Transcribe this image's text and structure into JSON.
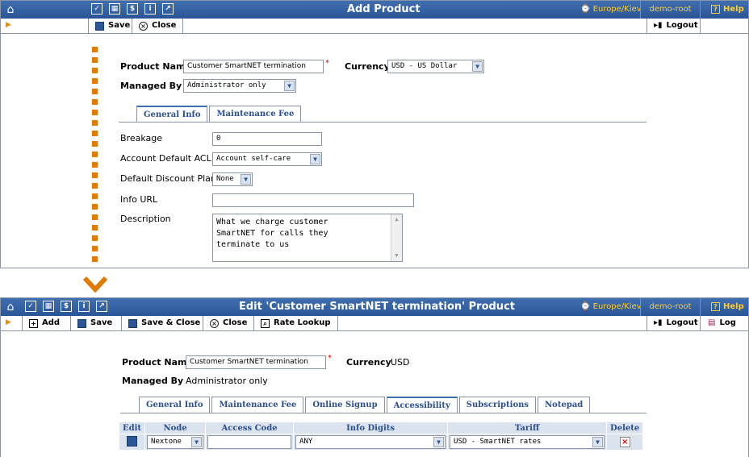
{
  "window1": {
    "title": "Add Product",
    "timezone": "Europe/Kiev",
    "user": "demo-root",
    "help": "Help",
    "toolbar": {
      "save": "Save",
      "close": "Close",
      "logout": "Logout"
    },
    "form": {
      "product_name_label": "Product Name",
      "product_name_value": "Customer SmartNET termination",
      "currency_label": "Currency",
      "currency_value": "USD - US Dollar",
      "managed_by_label": "Managed By",
      "managed_by_value": "Administrator only"
    },
    "tabs": [
      "General Info",
      "Maintenance Fee"
    ],
    "general": {
      "breakage_label": "Breakage",
      "breakage_value": "0",
      "acl_label": "Account Default ACL",
      "acl_value": "Account self-care",
      "discount_label": "Default Discount Plan",
      "discount_value": "None",
      "info_url_label": "Info URL",
      "info_url_value": "",
      "description_label": "Description",
      "description_value": "What we charge customer\nSmartNET for calls they\nterminate to us"
    }
  },
  "window2": {
    "title": "Edit 'Customer SmartNET termination' Product",
    "timezone": "Europe/Kiev",
    "user": "demo-root",
    "help": "Help",
    "toolbar": {
      "add": "Add",
      "save": "Save",
      "save_close": "Save & Close",
      "close": "Close",
      "rate_lookup": "Rate Lookup",
      "logout": "Logout",
      "log": "Log"
    },
    "form": {
      "product_name_label": "Product Name",
      "product_name_value": "Customer SmartNET termination",
      "currency_label": "Currency",
      "currency_value": "USD",
      "managed_by_label": "Managed By",
      "managed_by_value": "Administrator only"
    },
    "tabs": [
      "General Info",
      "Maintenance Fee",
      "Online Signup",
      "Accessibility",
      "Subscriptions",
      "Notepad"
    ],
    "table": {
      "headers": [
        "Edit",
        "Node",
        "Access Code",
        "Info Digits",
        "Tariff",
        "Delete"
      ],
      "row": {
        "node": "Nextone",
        "access_code": "",
        "info_digits": "ANY",
        "tariff": "USD - SmartNET rates"
      }
    }
  },
  "colors": {
    "titlebar": "#2a5597",
    "accent": "#e07b00",
    "tab_text": "#2a4f8f",
    "header_bg": "#dbe3ef"
  }
}
